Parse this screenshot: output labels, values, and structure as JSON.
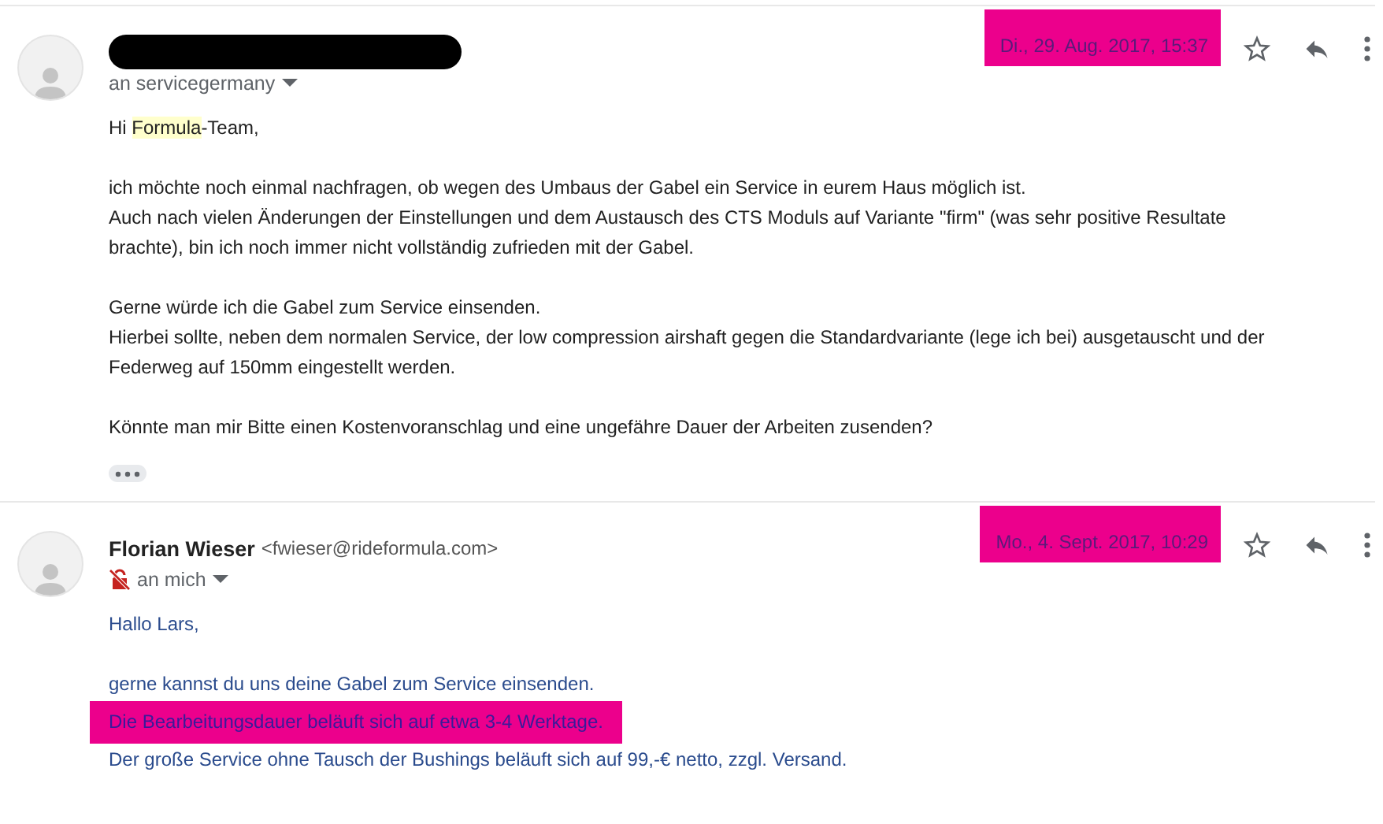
{
  "messages": [
    {
      "sender": {
        "redacted": true
      },
      "recipient": "an servicegermany",
      "date": "Di., 29. Aug. 2017, 15:37",
      "date_highlighted": true,
      "insecure": false,
      "blue_text": false,
      "paragraphs": [
        [
          [
            {
              "text": "Hi "
            },
            {
              "text": "Formula",
              "highlighted": true
            },
            {
              "text": "-Team,"
            }
          ]
        ],
        [
          [
            {
              "text": "ich möchte noch einmal nachfragen, ob wegen des Umbaus der Gabel ein Service in eurem Haus möglich ist."
            }
          ],
          [
            {
              "text": "Auch nach vielen Änderungen der Einstellungen und dem Austausch des CTS Moduls auf Variante \"firm\" (was sehr positive Resultate brachte), bin ich noch immer nicht vollständig zufrieden mit der Gabel."
            }
          ]
        ],
        [
          [
            {
              "text": "Gerne würde ich die Gabel zum Service einsenden."
            }
          ],
          [
            {
              "text": "Hierbei sollte, neben dem normalen Service, der low compression airshaft gegen die Standardvariante (lege ich bei) ausgetauscht und der Federweg auf 150mm eingestellt werden."
            }
          ]
        ],
        [
          [
            {
              "text": "Könnte man mir Bitte einen Kostenvoranschlag und eine ungefähre Dauer der Arbeiten zusenden?"
            }
          ]
        ]
      ],
      "trimmed": true
    },
    {
      "sender": {
        "redacted": false,
        "name": "Florian Wieser",
        "email": "<fwieser@rideformula.com>"
      },
      "recipient": "an mich",
      "date": "Mo., 4. Sept. 2017, 10:29",
      "date_highlighted": true,
      "insecure": true,
      "blue_text": true,
      "paragraphs": [
        [
          [
            {
              "text": "Hallo Lars,"
            }
          ]
        ],
        [
          [
            {
              "text": "gerne kannst du uns deine Gabel zum Service einsenden."
            }
          ],
          [
            {
              "text": "Die Bearbeitungsdauer beläuft sich auf etwa 3-4 Werktage.",
              "highlighted": true
            }
          ],
          [
            {
              "text": "Der große Service ohne Tausch der Bushings beläuft sich auf 99,-€ netto, zzgl. Versand."
            }
          ]
        ]
      ],
      "trimmed": false
    }
  ]
}
